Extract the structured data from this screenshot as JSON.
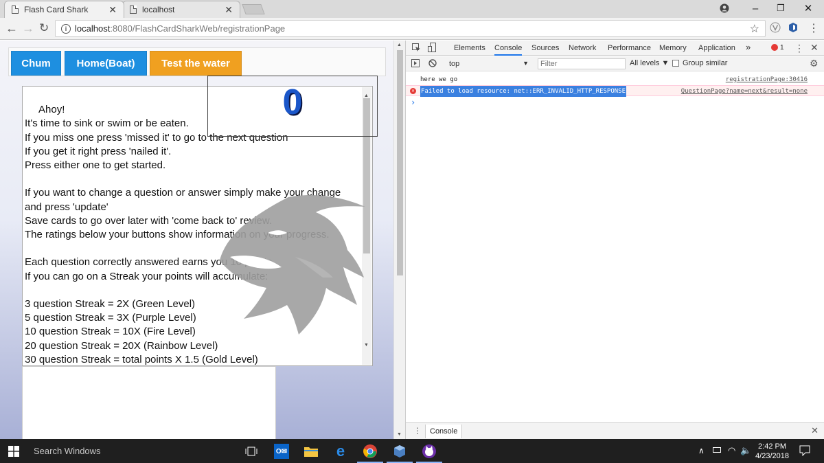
{
  "browser": {
    "tabs": [
      {
        "title": "Flash Card Shark",
        "active": true
      },
      {
        "title": "localhost",
        "active": false
      }
    ],
    "close_glyph": "✕",
    "window_controls": {
      "minimize": "–",
      "maximize": "❐",
      "close": "✕"
    },
    "address": {
      "host": "localhost",
      "path": ":8080/FlashCardSharkWeb/registrationPage"
    }
  },
  "page": {
    "nav_buttons": [
      {
        "label": "Chum",
        "color": "#1e8fe0"
      },
      {
        "label": "Home(Boat)",
        "color": "#1e8fe0"
      },
      {
        "label": "Test the water",
        "color": "#f0a020"
      }
    ],
    "score": "0",
    "instructions": " Ahoy!\nIt's time to sink or swim or be eaten.\nIf you miss one press 'missed it' to go to the next question\nIf you get it right press 'nailed it'.\nPress either one to get started.\n\nIf you want to change a question or answer simply make your change and press 'update'\nSave cards to go over later with 'come back to' review.\nThe ratings below your buttons show information on your progress.\n\nEach question correctly answered earns you 10 points.\nIf you can go on a Streak your points will accumulate:\n\n3 question Streak = 2X (Green Level)\n5 question Streak = 3X (Purple Level)\n10 question Streak = 10X (Fire Level)\n20 question Streak = 20X (Rainbow Level)\n30 question Streak = total points X 1.5 (Gold Level)"
  },
  "devtools": {
    "tabs": [
      "Elements",
      "Console",
      "Sources",
      "Network",
      "Performance",
      "Memory",
      "Application"
    ],
    "more": "»",
    "error_count": "1",
    "context": "top",
    "filter_placeholder": "Filter",
    "levels": "All levels ▼",
    "group_similar": "Group similar",
    "logs": [
      {
        "type": "log",
        "message": "here we go",
        "source": "registrationPage:30416"
      },
      {
        "type": "error",
        "message": "Failed to load resource: net::ERR_INVALID_HTTP_RESPONSE",
        "source": "QuestionPage?name=next&result=none"
      }
    ],
    "prompt": "›",
    "drawer_tab": "Console"
  },
  "taskbar": {
    "search_placeholder": "Search Windows",
    "time": "2:42 PM",
    "date": "4/23/2018"
  }
}
